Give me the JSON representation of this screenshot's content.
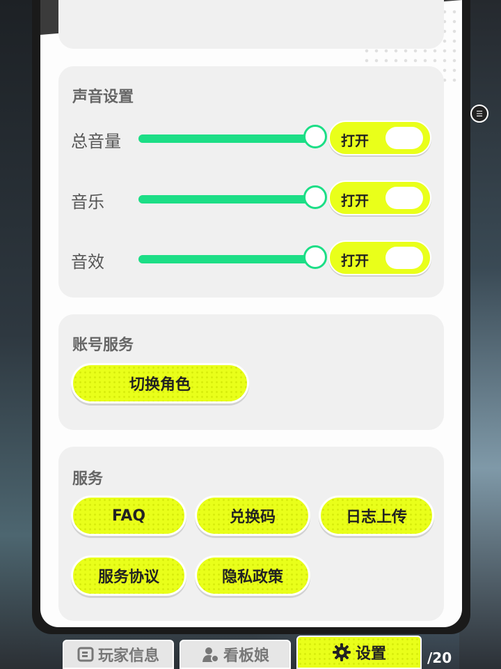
{
  "sound": {
    "title": "声音设置",
    "rows": [
      {
        "label": "总音量",
        "level": 1.0,
        "toggle": "打开"
      },
      {
        "label": "音乐",
        "level": 1.0,
        "toggle": "打开"
      },
      {
        "label": "音效",
        "level": 1.0,
        "toggle": "打开"
      }
    ]
  },
  "account": {
    "title": "账号服务",
    "switch_role": "切换角色"
  },
  "service": {
    "title": "服务",
    "buttons": [
      "FAQ",
      "兑换码",
      "日志上传",
      "服务协议",
      "隐私政策"
    ]
  },
  "tabs": {
    "player_info": "玩家信息",
    "mascot": "看板娘",
    "settings": "设置"
  },
  "page_count": "/20",
  "colors": {
    "accent_yellow": "#e9ff1a",
    "slider_green": "#1cde86",
    "section_bg": "#f0f0f0"
  }
}
